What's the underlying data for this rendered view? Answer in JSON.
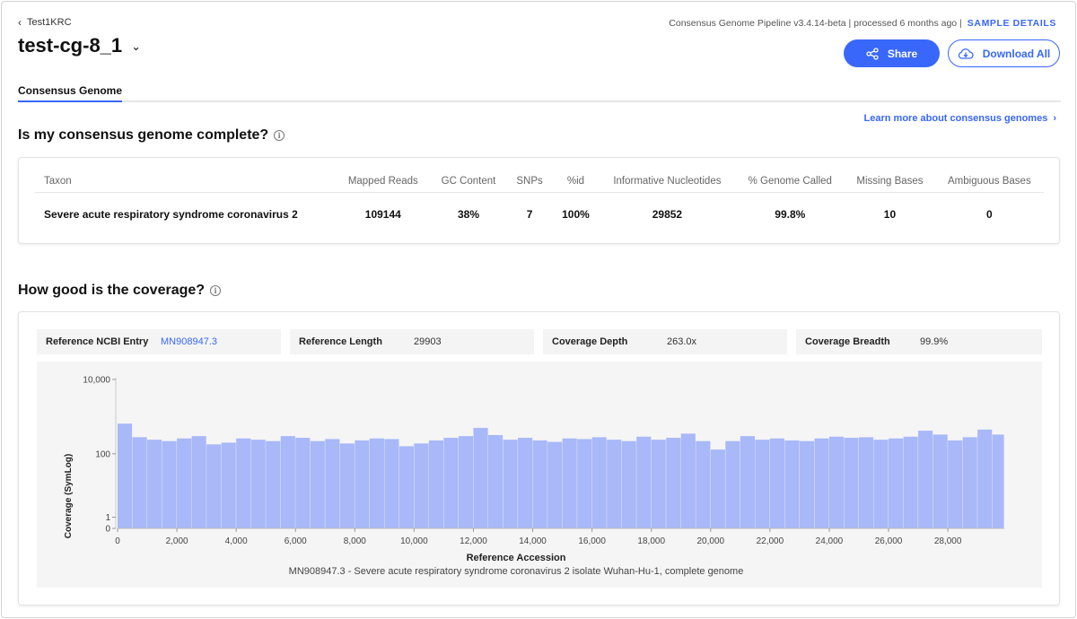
{
  "header": {
    "back_label": "Test1KRC",
    "sample_name": "test-cg-8_1",
    "pipeline_text": "Consensus Genome Pipeline v3.4.14-beta | processed 6 months ago |",
    "sample_details_label": "SAMPLE DETAILS",
    "share_label": "Share",
    "download_label": "Download All"
  },
  "tabs": [
    {
      "label": "Consensus Genome",
      "active": true
    }
  ],
  "learn_more_label": "Learn more about consensus genomes",
  "section1": {
    "title": "Is my consensus genome complete?",
    "columns": [
      "Taxon",
      "Mapped Reads",
      "GC Content",
      "SNPs",
      "%id",
      "Informative Nucleotides",
      "% Genome Called",
      "Missing Bases",
      "Ambiguous Bases"
    ],
    "row": [
      "Severe acute respiratory syndrome coronavirus 2",
      "109144",
      "38%",
      "7",
      "100%",
      "29852",
      "99.8%",
      "10",
      "0"
    ]
  },
  "section2": {
    "title": "How good is the coverage?",
    "stats": [
      {
        "label": "Reference NCBI Entry",
        "value": "MN908947.3",
        "is_link": true
      },
      {
        "label": "Reference Length",
        "value": "29903",
        "is_link": false
      },
      {
        "label": "Coverage Depth",
        "value": "263.0x",
        "is_link": false
      },
      {
        "label": "Coverage Breadth",
        "value": "99.9%",
        "is_link": false
      }
    ]
  },
  "colors": {
    "accent": "#3867fa",
    "bar": "#a8b8f8"
  },
  "chart_data": {
    "type": "bar",
    "title": "",
    "xlabel": "Reference Accession",
    "subtitle": "MN908947.3 - Severe acute respiratory syndrome coronavirus 2 isolate Wuhan-Hu-1, complete genome",
    "ylabel": "Coverage (SymLog)",
    "y_scale": "symlog",
    "ylim": [
      0,
      10000
    ],
    "xlim": [
      0,
      29903
    ],
    "x_ticks": [
      0,
      2000,
      4000,
      6000,
      8000,
      10000,
      12000,
      14000,
      16000,
      18000,
      20000,
      22000,
      24000,
      26000,
      28000
    ],
    "x_tick_labels": [
      "0",
      "2,000",
      "4,000",
      "6,000",
      "8,000",
      "10,000",
      "12,000",
      "14,000",
      "16,000",
      "18,000",
      "20,000",
      "22,000",
      "24,000",
      "26,000",
      "28,000"
    ],
    "y_ticks": [
      0,
      1,
      100,
      10000
    ],
    "y_tick_labels": [
      "0",
      "1",
      "100",
      "10,000"
    ],
    "bin_size": 500,
    "bins_start": [
      0,
      500,
      1000,
      1500,
      2000,
      2500,
      3000,
      3500,
      4000,
      4500,
      5000,
      5500,
      6000,
      6500,
      7000,
      7500,
      8000,
      8500,
      9000,
      9500,
      10000,
      10500,
      11000,
      11500,
      12000,
      12500,
      13000,
      13500,
      14000,
      14500,
      15000,
      15500,
      16000,
      16500,
      17000,
      17500,
      18000,
      18500,
      19000,
      19500,
      20000,
      20500,
      21000,
      21500,
      22000,
      22500,
      23000,
      23500,
      24000,
      24500,
      25000,
      25500,
      26000,
      26500,
      27000,
      27500,
      28000,
      28500,
      29000,
      29500
    ],
    "values": [
      650,
      280,
      240,
      220,
      260,
      300,
      180,
      200,
      260,
      240,
      220,
      300,
      270,
      220,
      250,
      190,
      230,
      260,
      250,
      160,
      190,
      230,
      270,
      300,
      500,
      320,
      240,
      270,
      230,
      210,
      260,
      250,
      280,
      240,
      220,
      290,
      240,
      270,
      350,
      220,
      130,
      220,
      300,
      240,
      260,
      230,
      220,
      260,
      290,
      270,
      280,
      240,
      260,
      290,
      420,
      330,
      230,
      280,
      450,
      330
    ]
  }
}
